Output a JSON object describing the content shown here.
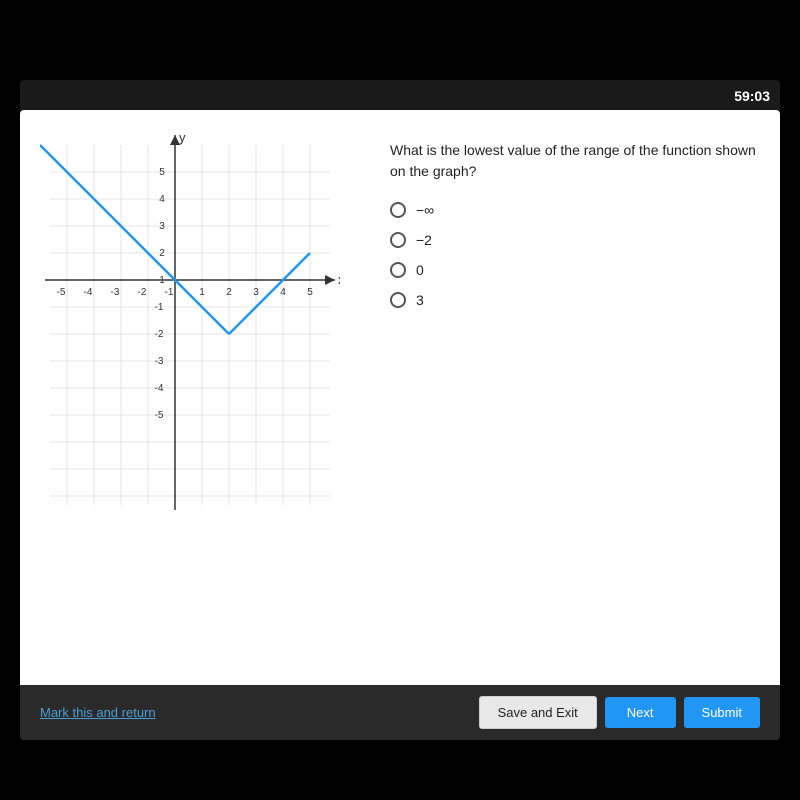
{
  "timer": "59:03",
  "question": {
    "text": "What is the lowest value of the range of the function shown on the graph?",
    "options": [
      {
        "id": "opt-neg-inf",
        "label": "-∞"
      },
      {
        "id": "opt-neg-2",
        "label": "-2"
      },
      {
        "id": "opt-0",
        "label": "0"
      },
      {
        "id": "opt-3",
        "label": "3"
      }
    ]
  },
  "buttons": {
    "mark": "Mark this and return",
    "save": "Save and Exit",
    "next": "Next",
    "submit": "Submit"
  },
  "graph": {
    "x_min": -5,
    "x_max": 5,
    "y_min": -5,
    "y_max": 5
  }
}
